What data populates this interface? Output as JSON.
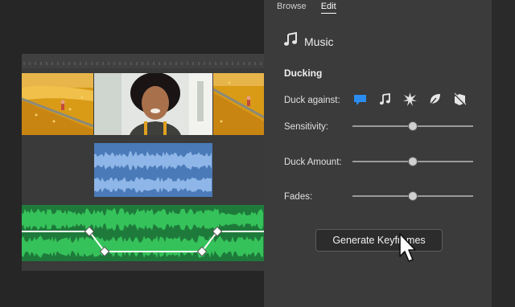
{
  "tabs": [
    {
      "label": "Browse",
      "active": false
    },
    {
      "label": "Edit",
      "active": true
    }
  ],
  "panel": {
    "icon": "music-note-icon",
    "title": "Music",
    "section_label": "Ducking",
    "duck_against_label": "Duck against:",
    "duck_against_icons": [
      {
        "name": "dialogue-icon",
        "selected": true
      },
      {
        "name": "music-note-icon",
        "selected": false
      },
      {
        "name": "sfx-burst-icon",
        "selected": false
      },
      {
        "name": "ambience-leaf-icon",
        "selected": false
      },
      {
        "name": "unclassified-icon",
        "selected": false
      }
    ],
    "sliders": [
      {
        "label": "Sensitivity:",
        "value": 0.5
      },
      {
        "label": "Duck Amount:",
        "value": 0.5
      },
      {
        "label": "Fades:",
        "value": 0.5
      }
    ],
    "generate_button_label": "Generate Keyframes"
  },
  "colors": {
    "accent_blue": "#2a8cf0",
    "dialogue_clip": "#4a7ab8",
    "music_clip": "#1e7a3b",
    "music_wave": "#36c25a"
  }
}
